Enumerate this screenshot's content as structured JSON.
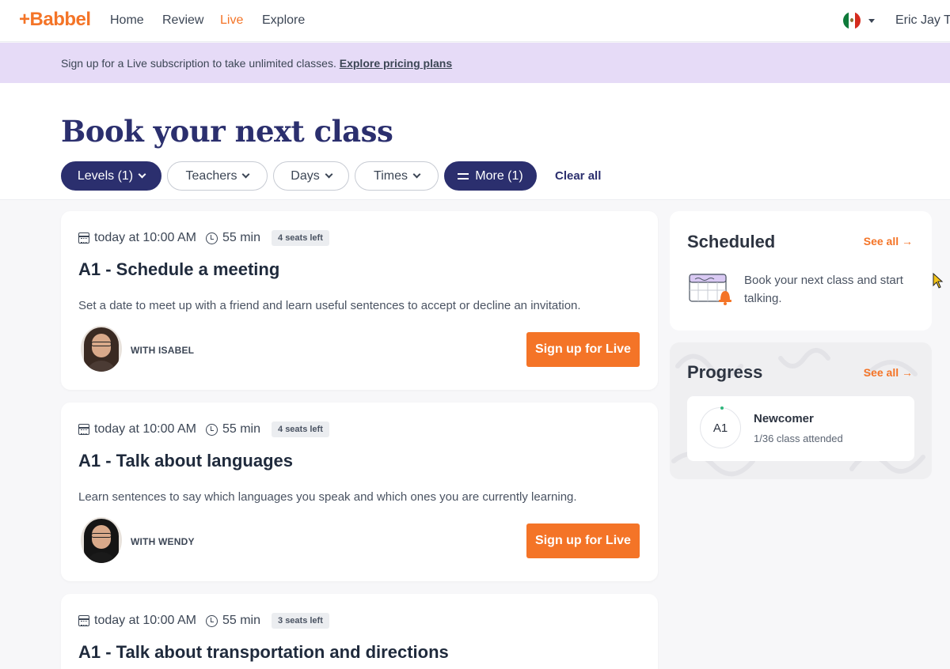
{
  "header": {
    "logo": "+Babbel",
    "nav": [
      {
        "label": "Home"
      },
      {
        "label": "Review"
      },
      {
        "label": "Live"
      },
      {
        "label": "Explore"
      }
    ],
    "active_nav": "Live",
    "flag_icon": "mexico-flag-icon",
    "user_name": "Eric Jay To"
  },
  "banner": {
    "text": "Sign up for a Live subscription to take unlimited classes.",
    "link": "Explore pricing plans"
  },
  "page": {
    "title": "Book your next class",
    "filters": [
      {
        "label": "Levels (1)",
        "active": true
      },
      {
        "label": "Teachers",
        "active": false
      },
      {
        "label": "Days",
        "active": false
      },
      {
        "label": "Times",
        "active": false
      },
      {
        "label": "More (1)",
        "active": true
      }
    ],
    "clear_all": "Clear all"
  },
  "classes": [
    {
      "time": "today at 10:00 AM",
      "duration": "55 min",
      "seats": "4 seats left",
      "title": "A1 - Schedule a meeting",
      "description": "Set a date to meet up with a friend and learn useful sentences to accept or decline an invitation.",
      "teacher": "WITH ISABEL",
      "button": "Sign up for Live"
    },
    {
      "time": "today at 10:00 AM",
      "duration": "55 min",
      "seats": "4 seats left",
      "title": "A1 - Talk about languages",
      "description": "Learn sentences to say which languages you speak and which ones you are currently learning.",
      "teacher": "WITH WENDY",
      "button": "Sign up for Live"
    },
    {
      "time": "today at 10:00 AM",
      "duration": "55 min",
      "seats": "3 seats left",
      "title": "A1 - Talk about transportation and directions"
    }
  ],
  "sidebar": {
    "scheduled": {
      "title": "Scheduled",
      "see_all": "See all →",
      "text": "Book your next class and start talking."
    },
    "progress": {
      "title": "Progress",
      "see_all": "See all →",
      "level": "A1",
      "level_name": "Newcomer",
      "attended": "1/36 class attended"
    }
  },
  "colors": {
    "brand_orange": "#f47427",
    "navy": "#2b2f6e",
    "banner_purple": "#e6dbf7"
  }
}
